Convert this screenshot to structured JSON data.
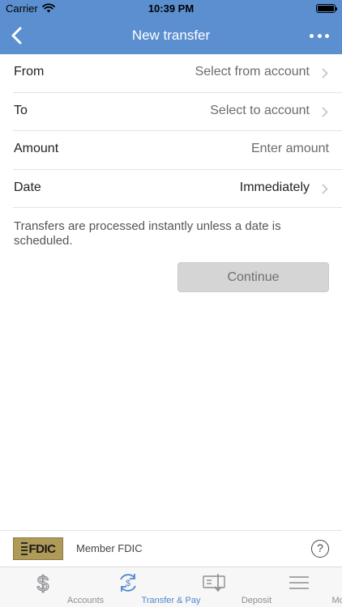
{
  "status_bar": {
    "carrier": "Carrier",
    "time": "10:39 PM"
  },
  "nav": {
    "title": "New transfer",
    "back_icon": "chevron-left-icon",
    "more_icon": "more-dots-icon"
  },
  "form": {
    "rows": [
      {
        "label": "From",
        "value": "Select from account"
      },
      {
        "label": "To",
        "value": "Select to account"
      },
      {
        "label": "Amount",
        "placeholder": "Enter amount"
      },
      {
        "label": "Date",
        "value": "Immediately"
      }
    ],
    "note": "Transfers are processed instantly unless a date is scheduled.",
    "continue_label": "Continue"
  },
  "footer": {
    "logo_text": "FDIC",
    "member_text": "Member FDIC",
    "help_label": "?"
  },
  "tabs": [
    {
      "label": "Accounts",
      "icon": "dollar-icon",
      "active": false
    },
    {
      "label": "Transfer & Pay",
      "icon": "transfer-icon",
      "active": true
    },
    {
      "label": "Deposit",
      "icon": "check-deposit-icon",
      "active": false
    },
    {
      "label": "More",
      "icon": "menu-icon",
      "active": false
    }
  ],
  "colors": {
    "header": "#5b8fd0",
    "tab_active": "#4f88cf",
    "tab_inactive": "#8e8e93",
    "button_disabled": "#d5d5d6",
    "fdic_gold": "#b09a57"
  }
}
